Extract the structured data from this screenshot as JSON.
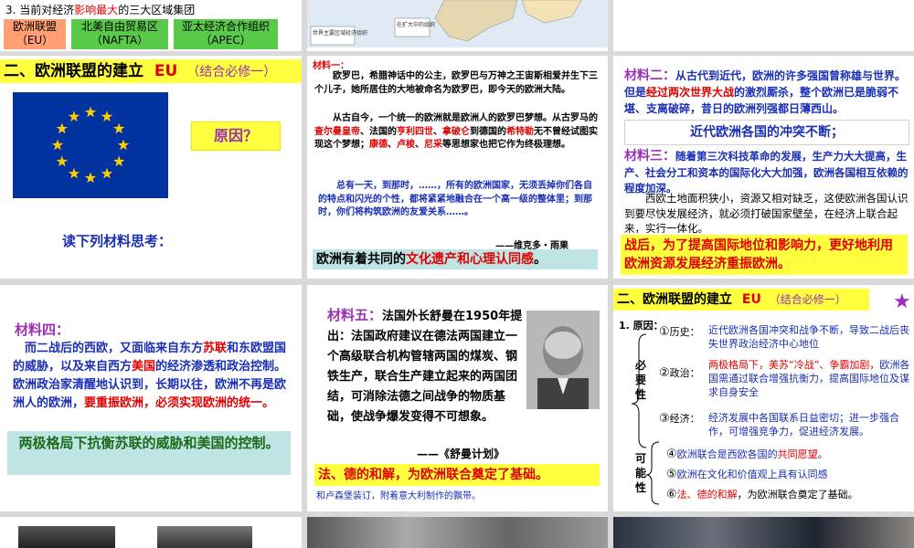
{
  "s1": {
    "heading_prefix": "3. 当前对经济",
    "heading_em": "影响最大",
    "heading_suffix": "的三大区域集团",
    "blocs": [
      {
        "name": "欧洲联盟",
        "abbr": "（EU）",
        "color": "#ff9f73"
      },
      {
        "name": "北美自由贸易区",
        "abbr": "（NAFTA）",
        "color": "#59c94a"
      },
      {
        "name": "亚太经济合作组织",
        "abbr": "（APEC）",
        "color": "#59c94a"
      }
    ]
  },
  "s2": {
    "map_text_1": "世界主要区域经济组织",
    "map_text_2": "在扩大中的组织"
  },
  "s4": {
    "title": "二、欧洲联盟的建立",
    "title_eu": "EU",
    "title_note": "（结合必修一）",
    "reason_label": "原因？",
    "prompt": "读下列材料思考："
  },
  "s5": {
    "label": "材料一：",
    "para1": "欧罗巴，希腊神话中的公主，欧罗巴与万神之王宙斯相爱并生下三个儿子，她所居住的大地被命名为欧罗巴，即今天的欧洲大陆。",
    "para2_a": "从古自今，一个统一的欧洲就是欧洲人的欧罗巴梦想。从古罗马的",
    "para2_r1": "查尔曼皇帝",
    "para2_b": "、法国的",
    "para2_r2": "亨利四世",
    "para2_c": "、",
    "para2_r3": "拿破仑",
    "para2_d": "到德国的",
    "para2_r4": "希特勒",
    "para2_e": "无不曾经试图实现这个梦想；",
    "para2_r5": "康德",
    "para2_f": "、",
    "para2_r6": "卢梭",
    "para2_g": "、",
    "para2_r7": "尼采",
    "para2_h": "等思想家也把它作为终极理想。",
    "quote": "总有一天，到那时，……，所有的欧洲国家，无须丢掉你们各自的特点和闪光的个性，都将紧紧地融合在一个高一级的整体里；到那时，你们将构筑欧洲的友爱关系……。",
    "attribution": "——维克多・雨果",
    "conclusion_a": "欧洲有着共同的",
    "conclusion_b": "文化遗产和心理认同感",
    "conclusion_c": "。"
  },
  "s6": {
    "label2": "材料二：",
    "text2_a": "从古代到近代，欧洲的许多强国曾称雄与世界。但是",
    "text2_r": "经过两次世界大战",
    "text2_b": "的激烈厮杀，整个欧洲已是脆弱不堪、支离破碎，昔日的欧洲列强都日薄西山。",
    "conflict": "近代欧洲各国的冲突不断；",
    "label3": "材料三：",
    "text3_a": "随着第三次科技革命的发展，生产力大大提高，生产、社会分工和资本的国际化大大加强，欧洲各国相互依赖的程度加深。",
    "text3_b": "西欧土地面积狭小，资源又相对缺乏，这使欧洲各国认识到要尽快发展经济，就必须打破国家壁垒，在经济上联合起来，实行一体化。",
    "conclusion": "战后，为了提高国际地位和影响力，更好地利用欧洲资源发展经济重振欧洲。"
  },
  "s7": {
    "label": "材料四：",
    "text_a": "而二战后的西欧，又面临来自东方",
    "text_r1": "苏联",
    "text_b": "和东欧盟国的威胁，以及来自西方",
    "text_r2": "美国",
    "text_c": "的经济渗透和政治控制。欧洲政治家清醒地认识到，长期以往，欧洲不再是欧洲人的欧洲，",
    "text_r3": "要重振欧洲，必须实现欧洲的统一。",
    "conclusion": "两极格局下抗衡苏联的威胁和美国的控制。"
  },
  "s8": {
    "label": "材料五：",
    "text": "法国外长舒曼在1950年提出：法国政府建议在德法两国建立一个高级联合机构管辖两国的煤炭、钢铁生产，联合生产建立起来的两国团结，可消除法德之间战争的物质基础，使战争爆发变得不可想象。",
    "source": "——《舒曼计划》",
    "conclusion": "法、德的和解，为欧洲联合奠定了基础。",
    "footer": "和卢森堡装订，附着意大利制作的飘带。"
  },
  "s9": {
    "title": "二、欧洲联盟的建立",
    "title_eu": "EU",
    "title_note": "（结合必修一）",
    "sub": "1. 原因：",
    "nec_label": "必要性",
    "pos_label": "可能性",
    "items": [
      {
        "num": "①",
        "head": "历史：",
        "body": "近代欧洲各国冲突和战争不断，导致二战后丧失世界政治经济中心地位"
      },
      {
        "num": "②",
        "head": "政治：",
        "body_r": "两极格局下，美苏“冷战”、争霸加剧，",
        "body": "欧洲各国需通过联合增强抗衡力，提高国际地位及谋求自身安全"
      },
      {
        "num": "③",
        "head": "经济：",
        "body_r": "经济发展中各国联系日益密切；",
        "body": "进一步强合作，可增强竞争力，促进经济发展。"
      },
      {
        "num": "④",
        "body_a": "欧洲联合是西欧各国的",
        "body_r": "共同愿望",
        "body_b": "。"
      },
      {
        "num": "⑤",
        "body": "欧洲在文化和价值观上具有认同感"
      },
      {
        "num": "⑥",
        "body_r": "法、德的和解",
        "body_b": "，为欧洲联合奠定了基础。"
      }
    ]
  },
  "colors": {
    "accent_red": "#e00000",
    "text_blue": "#1a2fb5",
    "label_purple": "#9b2fb5",
    "highlight_yellow": "#ffff3d",
    "highlight_teal": "#bfe4e4",
    "flag_blue": "#0033a0",
    "flag_gold": "#ffcc00"
  }
}
